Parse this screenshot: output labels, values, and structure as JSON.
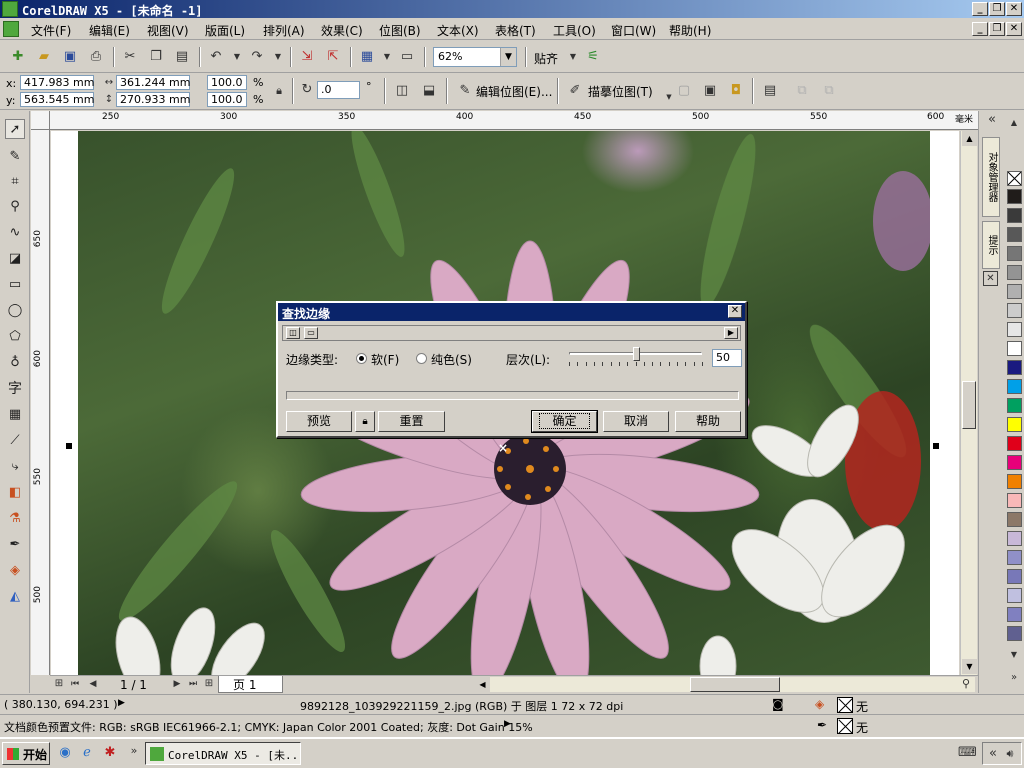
{
  "window": {
    "title": "CorelDRAW X5 - [未命名 -1]",
    "minimize": "_",
    "restore": "❐",
    "close": "✕"
  },
  "menu": {
    "items": [
      "文件(F)",
      "编辑(E)",
      "视图(V)",
      "版面(L)",
      "排列(A)",
      "效果(C)",
      "位图(B)",
      "文本(X)",
      "表格(T)",
      "工具(O)",
      "窗口(W)",
      "帮助(H)"
    ]
  },
  "toolbar": {
    "zoom_value": "62%",
    "snap_label": "贴齐"
  },
  "property_bar": {
    "x_label": "x:",
    "y_label": "y:",
    "x_value": "417.983 mm",
    "y_value": "563.545 mm",
    "width_value": "361.244 mm",
    "height_value": "270.933 mm",
    "scale_x": "100.0",
    "scale_y": "100.0",
    "percent": "%",
    "rotation": ".0",
    "degree": "°",
    "edit_bitmap": "编辑位图(E)...",
    "trace_bitmap": "描摹位图(T)"
  },
  "ruler": {
    "top_ticks": [
      "250",
      "300",
      "350",
      "400",
      "450",
      "500",
      "550",
      "600"
    ],
    "unit": "毫米",
    "left_ticks": [
      "650",
      "600",
      "550",
      "500"
    ]
  },
  "page_nav": {
    "page_count": "1 / 1",
    "page_tab": "页 1"
  },
  "docker": {
    "tab_object_manager": "对象管理器",
    "tab_hints": "提示"
  },
  "palette": {
    "colors": [
      "#201c1a",
      "#3a3a3a",
      "#585858",
      "#767676",
      "#949494",
      "#b0b0b0",
      "#cccccc",
      "#e6e6e6",
      "#ffffff",
      "#1a1a80",
      "#00a0e8",
      "#00a060",
      "#ffff00",
      "#e0001a",
      "#e8007a",
      "#f08000",
      "#f8b8b8",
      "#8c7868",
      "#c8b8d8",
      "#9090c8",
      "#7878b8",
      "#c0c0e0",
      "#8080c0",
      "#606090"
    ]
  },
  "dialog": {
    "title": "查找边缘",
    "edge_type_label": "边缘类型:",
    "option_soft": "软(F)",
    "option_solid": "纯色(S)",
    "level_label": "层次(L):",
    "level_value": "50",
    "level_fraction": 0.5,
    "preview_button": "预览",
    "reset_button": "重置",
    "ok_button": "确定",
    "cancel_button": "取消",
    "help_button": "帮助"
  },
  "status": {
    "cursor_coords": "( 380.130, 694.231 )",
    "object_info": "9892128_103929221159_2.jpg (RGB) 于 图层 1 72 x 72 dpi",
    "fill_none": "无",
    "outline_none": "无",
    "color_profile": "文档颜色预置文件: RGB: sRGB IEC61966-2.1; CMYK: Japan Color 2001 Coated; 灰度: Dot Gain 15%"
  },
  "taskbar": {
    "start_label": "开始",
    "task_title": "CorelDRAW X5 - [未..."
  }
}
